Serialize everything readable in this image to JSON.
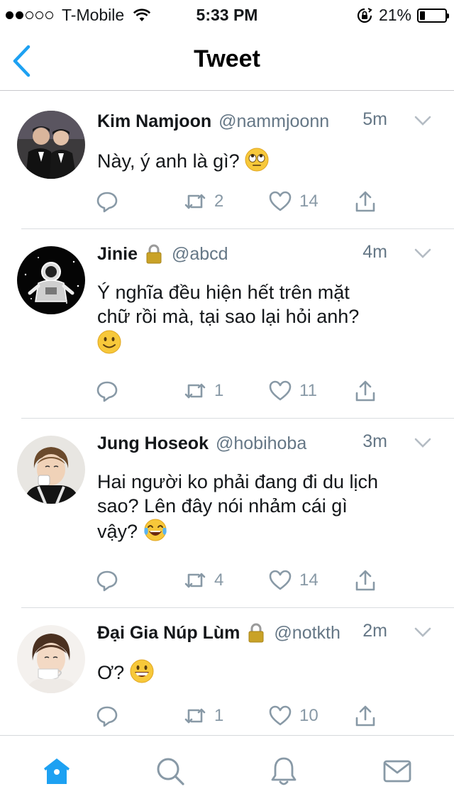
{
  "status_bar": {
    "carrier": "T-Mobile",
    "time": "5:33 PM",
    "battery_percent": "21%",
    "battery_level": 0.21,
    "signal_bars_filled": 2,
    "signal_bars_total": 5
  },
  "nav": {
    "title": "Tweet",
    "accent_color": "#1da1f2"
  },
  "tweets": [
    {
      "name": "Kim Namjoon",
      "handle": "@nammjoonn",
      "time": "5m",
      "locked": false,
      "text_lines": [
        "Này, ý anh là gì?"
      ],
      "emoji": "eye-roll-face",
      "replies": "",
      "retweets": "2",
      "likes": "14"
    },
    {
      "name": "Jinie",
      "handle": "@abcd",
      "time": "4m",
      "locked": true,
      "text_lines": [
        "Ý nghĩa đều hiện hết trên mặt",
        "chữ rồi mà, tại sao lại hỏi anh?"
      ],
      "emoji": "slight-smile-face",
      "replies": "",
      "retweets": "1",
      "likes": "11"
    },
    {
      "name": "Jung Hoseok",
      "handle": "@hobihoba",
      "time": "3m",
      "locked": false,
      "text_lines": [
        "Hai người ko phải đang đi du lịch",
        "sao? Lên đây nói nhảm cái gì",
        "vậy?"
      ],
      "emoji": "tears-of-joy-face",
      "replies": "",
      "retweets": "4",
      "likes": "14"
    },
    {
      "name": "Đại Gia Núp Lùm",
      "handle": "@notkth",
      "time": "2m",
      "locked": true,
      "text_lines": [
        "Ơ?"
      ],
      "emoji": "grinning-face",
      "replies": "",
      "retweets": "1",
      "likes": "10"
    }
  ],
  "tab_bar": {
    "items": [
      "home-icon",
      "search-icon",
      "notifications-bell-icon",
      "messages-envelope-icon"
    ],
    "active": "home-icon"
  },
  "colors": {
    "accent": "#1da1f2",
    "secondary_text": "#657786",
    "action_icons": "#8899a6"
  }
}
